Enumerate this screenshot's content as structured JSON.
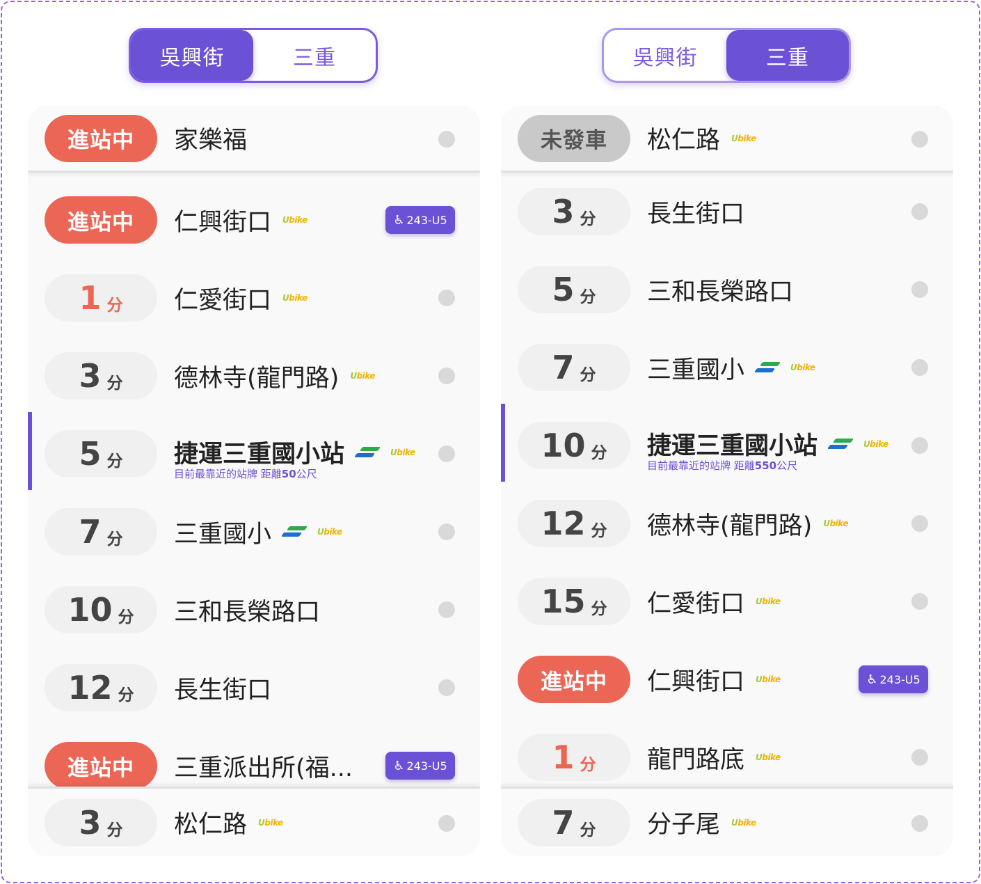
{
  "colors": {
    "accent": "#6b51d6",
    "arriving": "#ec6656",
    "not_departed": "#c9c9c9"
  },
  "left": {
    "toggle": {
      "active": "吳興街",
      "inactive": "三重"
    },
    "pinned_top": {
      "status": "進站中",
      "name": "家樂福"
    },
    "rows": [
      {
        "status": "進站中",
        "name": "仁興街口",
        "ubike": "Ubike",
        "bus": "243-U5"
      },
      {
        "num": "1",
        "unit": "分",
        "near": true,
        "name": "仁愛街口",
        "ubike": "Ubike"
      },
      {
        "num": "3",
        "unit": "分",
        "name": "德林寺(龍門路)",
        "ubike": "Ubike"
      },
      {
        "num": "5",
        "unit": "分",
        "name": "捷運三重國小站",
        "metro": true,
        "ubike": "Ubike",
        "current": true,
        "sub_prefix": "目前最靠近的站牌 距離",
        "sub_dist": "50",
        "sub_unit": "公尺"
      },
      {
        "num": "7",
        "unit": "分",
        "name": "三重國小",
        "metro": true,
        "ubike": "Ubike"
      },
      {
        "num": "10",
        "unit": "分",
        "name": "三和長榮路口"
      },
      {
        "num": "12",
        "unit": "分",
        "name": "長生街口"
      },
      {
        "status": "進站中",
        "name": "三重派出所(福...",
        "bus": "243-U5"
      }
    ],
    "pinned_bottom": {
      "num": "3",
      "unit": "分",
      "name": "松仁路",
      "ubike": "Ubike"
    }
  },
  "right": {
    "toggle": {
      "active": "三重",
      "inactive": "吳興街"
    },
    "pinned_top": {
      "status": "未發車",
      "name": "松仁路",
      "ubike": "Ubike"
    },
    "rows": [
      {
        "num": "3",
        "unit": "分",
        "name": "長生街口"
      },
      {
        "num": "5",
        "unit": "分",
        "name": "三和長榮路口"
      },
      {
        "num": "7",
        "unit": "分",
        "name": "三重國小",
        "metro": true,
        "ubike": "Ubike"
      },
      {
        "num": "10",
        "unit": "分",
        "name": "捷運三重國小站",
        "metro": true,
        "ubike": "Ubike",
        "current": true,
        "sub_prefix": "目前最靠近的站牌 距離",
        "sub_dist": "550",
        "sub_unit": "公尺"
      },
      {
        "num": "12",
        "unit": "分",
        "name": "德林寺(龍門路)",
        "ubike": "Ubike"
      },
      {
        "num": "15",
        "unit": "分",
        "name": "仁愛街口",
        "ubike": "Ubike"
      },
      {
        "status": "進站中",
        "name": "仁興街口",
        "ubike": "Ubike",
        "bus": "243-U5"
      },
      {
        "num": "1",
        "unit": "分",
        "near": true,
        "name": "龍門路底",
        "ubike": "Ubike"
      }
    ],
    "pinned_bottom": {
      "num": "7",
      "unit": "分",
      "name": "分子尾",
      "ubike": "Ubike"
    }
  }
}
